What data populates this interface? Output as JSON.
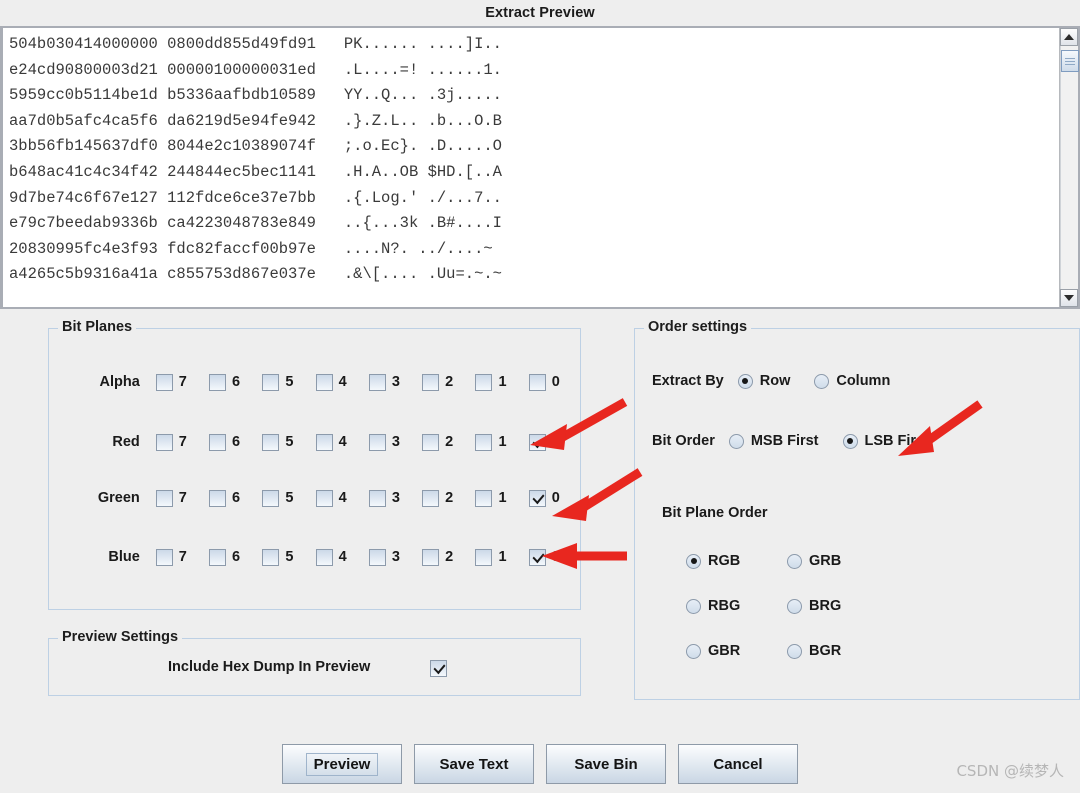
{
  "window": {
    "title": "Extract Preview"
  },
  "hex_preview": {
    "lines": [
      {
        "hex1": "504b030414000000",
        "hex2": "0800dd855d49fd91",
        "ascii1": "PK......",
        "ascii2": "....]I.."
      },
      {
        "hex1": "e24cd90800003d21",
        "hex2": "00000100000031ed",
        "ascii1": ".L....=!",
        "ascii2": "......1."
      },
      {
        "hex1": "5959cc0b5114be1d",
        "hex2": "b5336aafbdb10589",
        "ascii1": "YY..Q...",
        "ascii2": ".3j....."
      },
      {
        "hex1": "aa7d0b5afc4ca5f6",
        "hex2": "da6219d5e94fe942",
        "ascii1": ".}.Z.L..",
        "ascii2": ".b...O.B"
      },
      {
        "hex1": "3bb56fb145637df0",
        "hex2": "8044e2c10389074f",
        "ascii1": ";.o.Ec}.",
        "ascii2": ".D.....O"
      },
      {
        "hex1": "b648ac41c4c34f42",
        "hex2": "244844ec5bec1141",
        "ascii1": ".H.A..OB",
        "ascii2": "$HD.[..A"
      },
      {
        "hex1": "9d7be74c6f67e127",
        "hex2": "112fdce6ce37e7bb",
        "ascii1": ".{.Log.'",
        "ascii2": "./...7.."
      },
      {
        "hex1": "e79c7beedab9336b",
        "hex2": "ca4223048783e849",
        "ascii1": "..{...3k",
        "ascii2": ".B#....I"
      },
      {
        "hex1": "20830995fc4e3f93",
        "hex2": "fdc82faccf00b97e",
        "ascii1": "....N?.",
        "ascii2": "../....~"
      },
      {
        "hex1": "a4265c5b9316a41a",
        "hex2": "c855753d867e037e",
        "ascii1": ".&\\[....",
        "ascii2": ".Uu=.~.~"
      }
    ]
  },
  "scrollbar": {
    "up_icon": "scroll-up-arrow",
    "down_icon": "scroll-down-arrow"
  },
  "bit_planes": {
    "title": "Bit Planes",
    "bit_labels": [
      "7",
      "6",
      "5",
      "4",
      "3",
      "2",
      "1",
      "0"
    ],
    "channels": [
      {
        "name": "Alpha",
        "checked": [
          false,
          false,
          false,
          false,
          false,
          false,
          false,
          false
        ]
      },
      {
        "name": "Red",
        "checked": [
          false,
          false,
          false,
          false,
          false,
          false,
          false,
          true
        ]
      },
      {
        "name": "Green",
        "checked": [
          false,
          false,
          false,
          false,
          false,
          false,
          false,
          true
        ]
      },
      {
        "name": "Blue",
        "checked": [
          false,
          false,
          false,
          false,
          false,
          false,
          false,
          true
        ]
      }
    ]
  },
  "preview_settings": {
    "title": "Preview Settings",
    "include_hex_dump_label": "Include Hex Dump In Preview",
    "include_hex_dump_checked": true
  },
  "order_settings": {
    "title": "Order settings",
    "extract_by_label": "Extract By",
    "extract_by_options": [
      "Row",
      "Column"
    ],
    "extract_by_selected": "Row",
    "bit_order_label": "Bit Order",
    "bit_order_options": [
      "MSB First",
      "LSB First"
    ],
    "bit_order_selected": "LSB First",
    "bit_plane_order_label": "Bit Plane Order",
    "bit_plane_order_options": [
      "RGB",
      "GRB",
      "RBG",
      "BRG",
      "GBR",
      "BGR"
    ],
    "bit_plane_order_selected": "RGB"
  },
  "buttons": {
    "preview": "Preview",
    "save_text": "Save Text",
    "save_bin": "Save Bin",
    "cancel": "Cancel"
  },
  "watermark": {
    "text": "CSDN @续梦人"
  },
  "colors": {
    "panel_bg": "#eeeeee",
    "group_border": "#bdd0e4",
    "arrow_red": "#e8271f",
    "text": "#1a1a1a"
  }
}
